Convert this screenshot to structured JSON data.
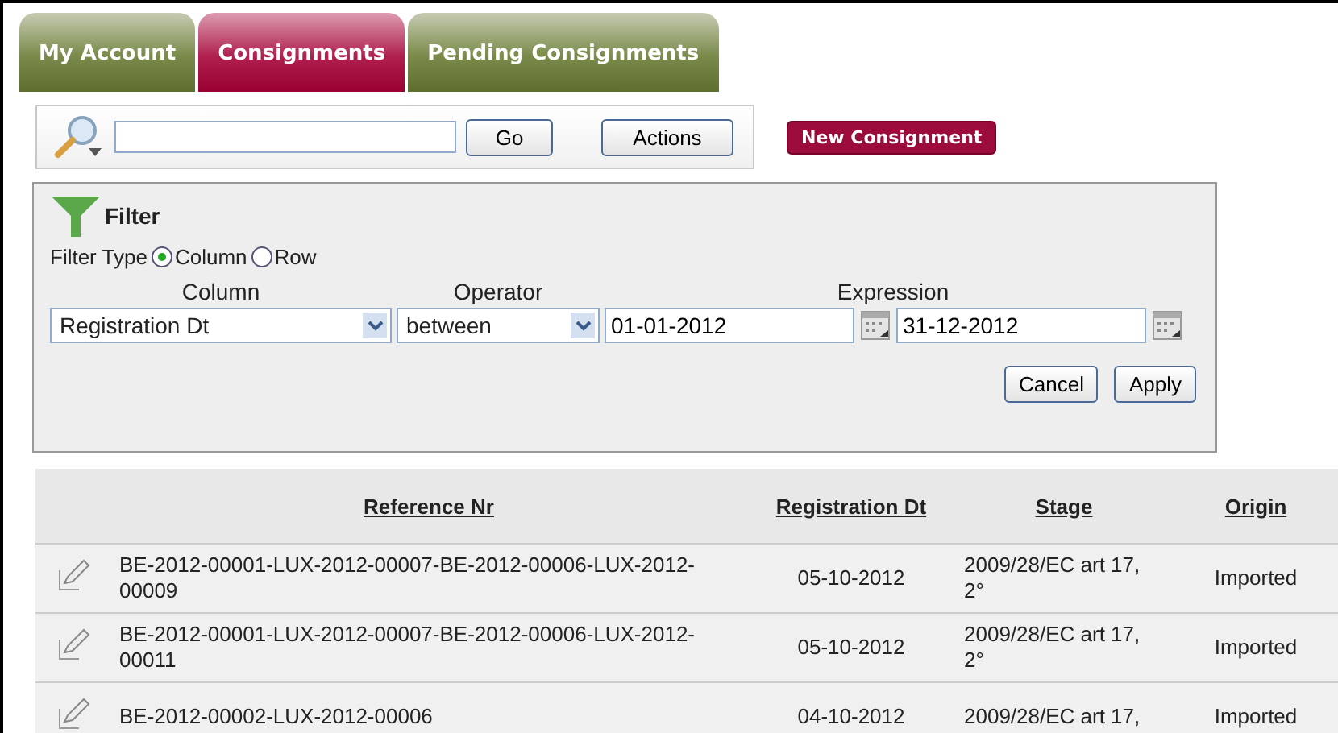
{
  "tabs": [
    {
      "label": "My Account",
      "selected": false
    },
    {
      "label": "Consignments",
      "selected": true
    },
    {
      "label": "Pending Consignments",
      "selected": false
    }
  ],
  "search": {
    "go_button": "Go",
    "actions_button": "Actions"
  },
  "new_button": "New Consignment",
  "filter": {
    "title": "Filter",
    "type_label": "Filter Type",
    "types": [
      {
        "label": "Column",
        "selected": true
      },
      {
        "label": "Row",
        "selected": false
      }
    ],
    "column_label": "Column",
    "operator_label": "Operator",
    "expression_label": "Expression",
    "column_value": "Registration Dt",
    "operator_value": "between",
    "from_value": "01-01-2012",
    "to_value": "31-12-2012",
    "cancel_button": "Cancel",
    "apply_button": "Apply"
  },
  "table": {
    "columns": [
      "Reference Nr",
      "Registration Dt",
      "Stage",
      "Origin"
    ],
    "rows": [
      {
        "reference": "BE-2012-00001-LUX-2012-00007-BE-2012-00006-LUX-2012-00009",
        "date": "05-10-2012",
        "stage": "2009/28/EC art 17, 2°",
        "origin": "Imported"
      },
      {
        "reference": "BE-2012-00001-LUX-2012-00007-BE-2012-00006-LUX-2012-00011",
        "date": "05-10-2012",
        "stage": "2009/28/EC art 17, 2°",
        "origin": "Imported"
      },
      {
        "reference": "BE-2012-00002-LUX-2012-00006",
        "date": "04-10-2012",
        "stage": "2009/28/EC art 17,",
        "origin": "Imported"
      }
    ]
  }
}
